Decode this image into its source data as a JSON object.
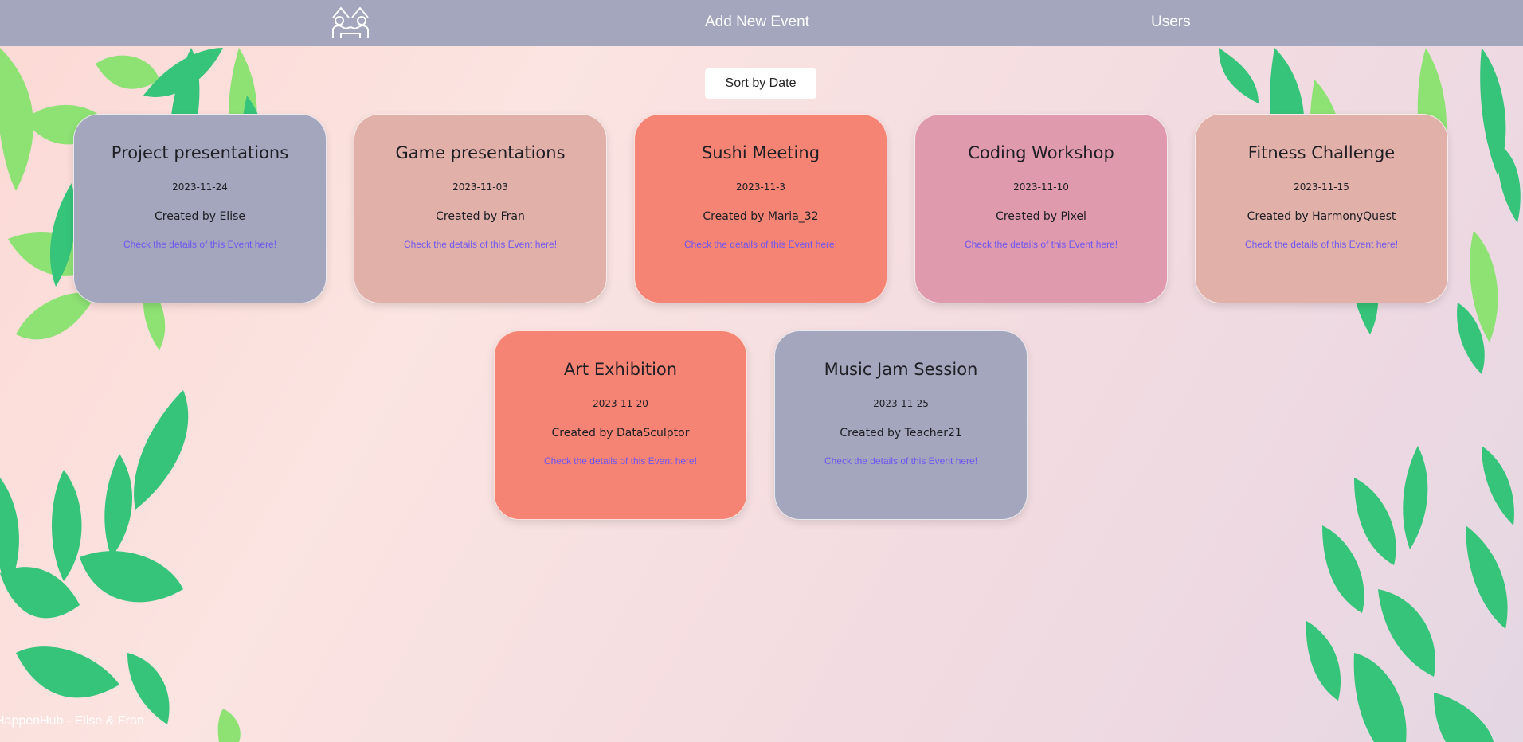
{
  "nav": {
    "add_event": "Add New Event",
    "users": "Users",
    "logo_icon": "people-house-logo-icon"
  },
  "sort_button": "Sort by Date",
  "colors": {
    "navbar": "#a3a6bc",
    "leaf_dark": "#35c47a",
    "leaf_light": "#8ee274",
    "link": "#6f56f1"
  },
  "events": [
    {
      "title": "Project presentations",
      "date": "2023-11-24",
      "creator": "Created by Elise",
      "link": "Check the details of this Event here!",
      "color": "#a3a6bc"
    },
    {
      "title": "Game presentations",
      "date": "2023-11-03",
      "creator": "Created by Fran",
      "link": "Check the details of this Event here!",
      "color": "#e1b0a9"
    },
    {
      "title": "Sushi Meeting",
      "date": "2023-11-3",
      "creator": "Created by Maria_32",
      "link": "Check the details of this Event here!",
      "color": "#f58474"
    },
    {
      "title": "Coding Workshop",
      "date": "2023-11-10",
      "creator": "Created by Pixel",
      "link": "Check the details of this Event here!",
      "color": "#df9aae"
    },
    {
      "title": "Fitness Challenge",
      "date": "2023-11-15",
      "creator": "Created by HarmonyQuest",
      "link": "Check the details of this Event here!",
      "color": "#e1b0a9"
    },
    {
      "title": "Art Exhibition",
      "date": "2023-11-20",
      "creator": "Created by DataSculptor",
      "link": "Check the details of this Event here!",
      "color": "#f58474"
    },
    {
      "title": "Music Jam Session",
      "date": "2023-11-25",
      "creator": "Created by Teacher21",
      "link": "Check the details of this Event here!",
      "color": "#a3a6bc"
    }
  ],
  "footer": "HappenHub - Elise & Fran"
}
